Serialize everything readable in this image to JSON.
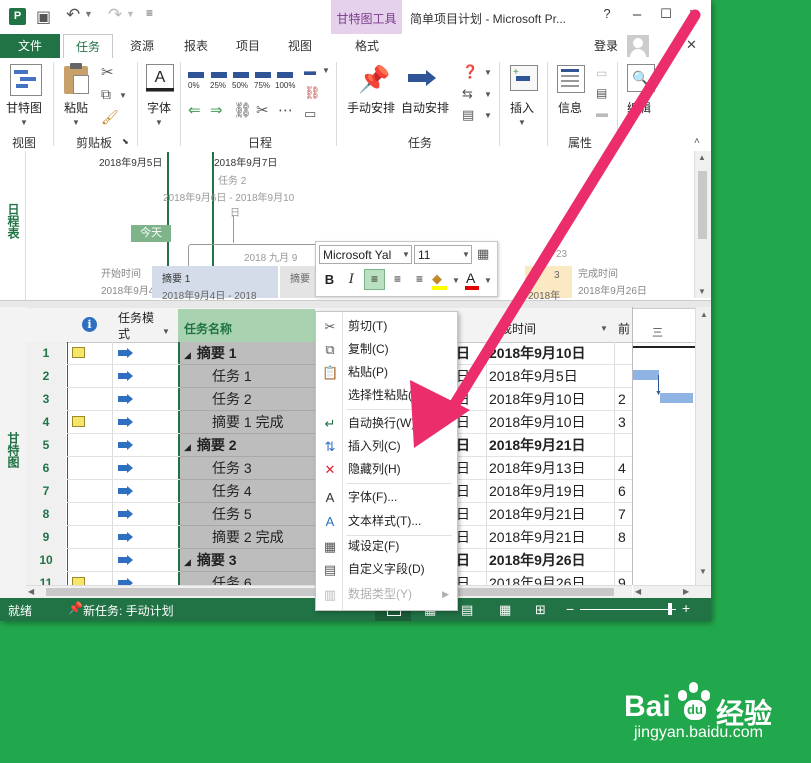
{
  "window": {
    "title": "简单项目计划 - Microsoft Pr...",
    "contextual_tab_group": "甘特图工具",
    "help": "?",
    "minimize": "–",
    "maximize": "☐",
    "close": "✕"
  },
  "tabs": {
    "file": "文件",
    "items": [
      "任务",
      "资源",
      "报表",
      "项目",
      "视图",
      "格式"
    ],
    "sign_in": "登录"
  },
  "ribbon": {
    "gantt_chart": "甘特图",
    "paste": "粘贴",
    "font": "字体",
    "manual_schedule": "手动安排",
    "auto_schedule": "自动安排",
    "insert": "插入",
    "info": "信息",
    "edit": "编辑",
    "percent_labels": [
      "0%",
      "25%",
      "50%",
      "75%",
      "100%"
    ],
    "groups": [
      "视图",
      "剪贴板",
      "日程",
      "任务",
      "属性"
    ]
  },
  "timeline": {
    "label": "日程表",
    "today": "今天",
    "date_left": "2018年9月5日",
    "date_right": "2018年9月7日",
    "task2": "任务 2",
    "task2_range_a": "2018年9月6日 - 2018年9月10",
    "task2_range_b": "日",
    "start_label": "开始时间",
    "start_date": "2018年9月4日",
    "finish_label": "完成时间",
    "finish_date": "2018年9月26日",
    "summary1": "摘要 1",
    "summary1_range": "2018年9月4日 - 2018",
    "summary_partial": "摘要",
    "month_label": "2018 九月 9",
    "date_23": "23",
    "summary3_partial": "3",
    "summary3_date": "2018年"
  },
  "mini_toolbar": {
    "font_name": "Microsoft Yal",
    "font_size": "11",
    "bold": "B",
    "italic": "I"
  },
  "grid": {
    "side_label": "甘特图",
    "headers": {
      "info": "i",
      "mode_line1": "任务模",
      "mode_line2": "式",
      "name": "任务名称",
      "finish": "成时间",
      "pred": "前",
      "chart_tier": "三"
    },
    "rows": [
      {
        "num": "1",
        "name": "摘要 1",
        "finish": "2018年9月10日",
        "pred": "",
        "summary": true,
        "note": true
      },
      {
        "num": "2",
        "name": "任务 1",
        "finish": "2018年9月5日",
        "pred": "",
        "summary": false,
        "note": false
      },
      {
        "num": "3",
        "name": "任务 2",
        "finish": "2018年9月10日",
        "pred": "2",
        "summary": false,
        "note": false
      },
      {
        "num": "4",
        "name": "摘要 1 完成",
        "finish": "2018年9月10日",
        "pred": "3",
        "summary": false,
        "note": true
      },
      {
        "num": "5",
        "name": "摘要 2",
        "finish": "2018年9月21日",
        "pred": "",
        "summary": true,
        "note": false
      },
      {
        "num": "6",
        "name": "任务 3",
        "finish": "2018年9月13日",
        "pred": "4",
        "summary": false,
        "note": false
      },
      {
        "num": "7",
        "name": "任务 4",
        "finish": "2018年9月19日",
        "pred": "6",
        "summary": false,
        "note": false
      },
      {
        "num": "8",
        "name": "任务 5",
        "finish": "2018年9月21日",
        "pred": "7",
        "summary": false,
        "note": false
      },
      {
        "num": "9",
        "name": "摘要 2 完成",
        "finish": "2018年9月21日",
        "pred": "8",
        "summary": false,
        "note": false
      },
      {
        "num": "10",
        "name": "摘要 3",
        "finish": "2018年9月26日",
        "pred": "",
        "summary": true,
        "note": false
      },
      {
        "num": "11",
        "name": "任务 6",
        "finish": "2018年9月26日",
        "pred": "9",
        "summary": false,
        "note": true
      }
    ],
    "col_d_partial": "日"
  },
  "context_menu": [
    {
      "label": "剪切(T)",
      "icon": "scissors-icon",
      "glyph": "✂",
      "disabled": false
    },
    {
      "label": "复制(C)",
      "icon": "copy-icon",
      "glyph": "⧉",
      "disabled": false
    },
    {
      "label": "粘贴(P)",
      "icon": "paste-icon",
      "glyph": "📋",
      "disabled": false
    },
    {
      "label": "选择性粘贴(S)...",
      "icon": "",
      "glyph": "",
      "disabled": false
    },
    {
      "label": "自动换行(W)",
      "icon": "wrap-text-icon",
      "glyph": "↵",
      "disabled": false
    },
    {
      "label": "插入列(C)",
      "icon": "insert-column-icon",
      "glyph": "⇅",
      "disabled": false
    },
    {
      "label": "隐藏列(H)",
      "icon": "hide-column-icon",
      "glyph": "✕",
      "disabled": false
    },
    {
      "label": "字体(F)...",
      "icon": "font-icon",
      "glyph": "A",
      "disabled": false
    },
    {
      "label": "文本样式(T)...",
      "icon": "text-style-icon",
      "glyph": "A",
      "disabled": false
    },
    {
      "label": "域设定(F)",
      "icon": "field-settings-icon",
      "glyph": "▦",
      "disabled": false
    },
    {
      "label": "自定义字段(D)",
      "icon": "custom-fields-icon",
      "glyph": "▤",
      "disabled": false
    },
    {
      "label": "数据类型(Y)",
      "icon": "data-type-icon",
      "glyph": "▥",
      "disabled": true
    }
  ],
  "status": {
    "ready": "就绪",
    "new_tasks": "新任务: 手动计划"
  },
  "watermark": {
    "brand": "Bai",
    "brand_cn": "经验",
    "url": "jingyan.baidu.com"
  },
  "colors": {
    "accent": "#217346",
    "background": "#22a84c",
    "arrow": "#ec2d6b"
  }
}
